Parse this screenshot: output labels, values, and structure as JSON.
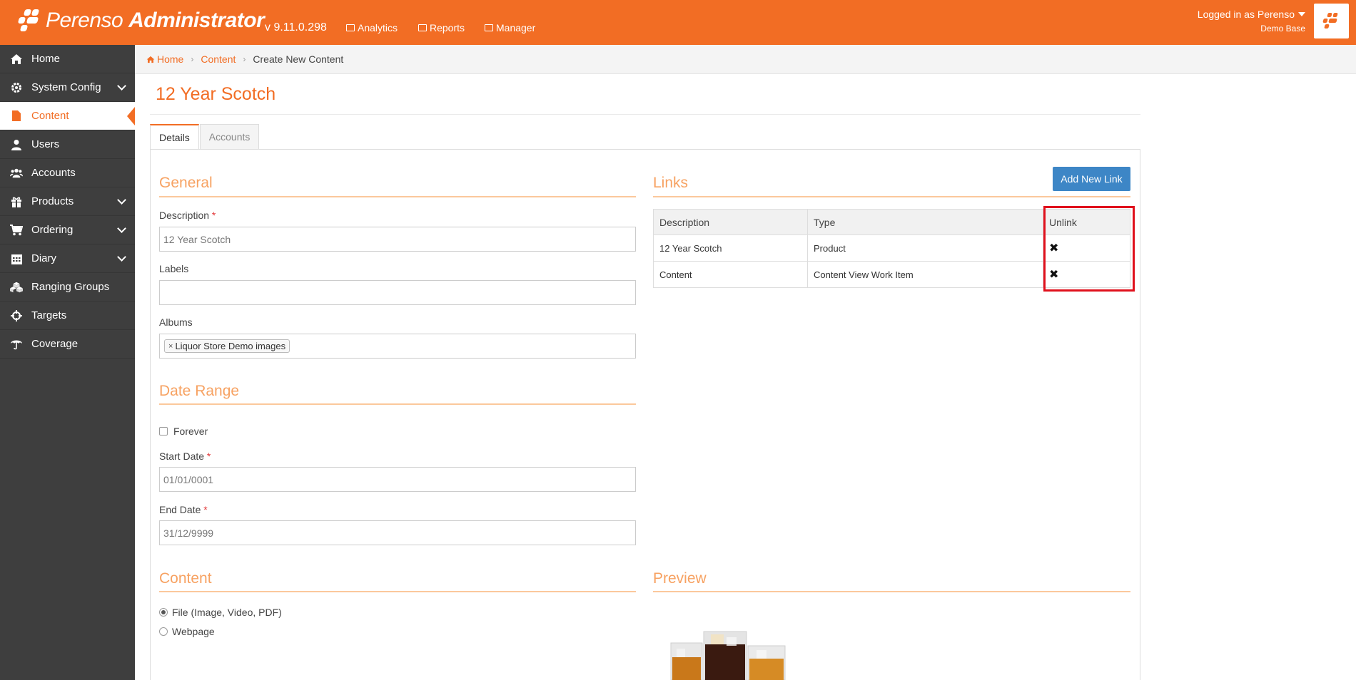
{
  "app": {
    "logo_text_1": "Perenso",
    "logo_text_2": "Administrator",
    "version": "v 9.11.0.298",
    "nav": [
      {
        "label": "Analytics",
        "icon": "chart-icon"
      },
      {
        "label": "Reports",
        "icon": "table-icon"
      },
      {
        "label": "Manager",
        "icon": "briefcase-icon"
      }
    ],
    "user": {
      "logged_in": "Logged in as Perenso",
      "base": "Demo Base"
    }
  },
  "sidebar": {
    "items": [
      {
        "label": "Home",
        "icon": "home-icon",
        "expandable": false,
        "active": false
      },
      {
        "label": "System Config",
        "icon": "gear-icon",
        "expandable": true,
        "active": false
      },
      {
        "label": "Content",
        "icon": "file-icon",
        "expandable": false,
        "active": true
      },
      {
        "label": "Users",
        "icon": "user-icon",
        "expandable": false,
        "active": false
      },
      {
        "label": "Accounts",
        "icon": "users-icon",
        "expandable": false,
        "active": false
      },
      {
        "label": "Products",
        "icon": "gift-icon",
        "expandable": true,
        "active": false
      },
      {
        "label": "Ordering",
        "icon": "cart-icon",
        "expandable": true,
        "active": false
      },
      {
        "label": "Diary",
        "icon": "calendar-icon",
        "expandable": true,
        "active": false
      },
      {
        "label": "Ranging Groups",
        "icon": "cubes-icon",
        "expandable": false,
        "active": false
      },
      {
        "label": "Targets",
        "icon": "crosshair-icon",
        "expandable": false,
        "active": false
      },
      {
        "label": "Coverage",
        "icon": "umbrella-icon",
        "expandable": false,
        "active": false
      }
    ]
  },
  "breadcrumb": {
    "home": "Home",
    "content": "Content",
    "current": "Create New Content"
  },
  "page": {
    "title": "12 Year Scotch"
  },
  "tabs": {
    "details": "Details",
    "accounts": "Accounts"
  },
  "general": {
    "heading": "General",
    "description_label": "Description",
    "description_value": "12 Year Scotch",
    "labels_label": "Labels",
    "labels_value": "",
    "albums_label": "Albums",
    "album_chip": "Liquor Store Demo images",
    "required_mark": "*"
  },
  "date_range": {
    "heading": "Date Range",
    "forever": "Forever",
    "start_label": "Start Date",
    "start_value": "01/01/0001",
    "end_label": "End Date",
    "end_value": "31/12/9999"
  },
  "content": {
    "heading": "Content",
    "options": [
      "File (Image, Video, PDF)",
      "Webpage"
    ],
    "selected": "File (Image, Video, PDF)"
  },
  "links": {
    "heading": "Links",
    "add_button": "Add New Link",
    "columns": [
      "Description",
      "Type",
      "Unlink"
    ],
    "rows": [
      {
        "description": "12 Year Scotch",
        "type": "Product",
        "unlink": "✖"
      },
      {
        "description": "Content",
        "type": "Content View Work Item",
        "unlink": "✖"
      }
    ]
  },
  "preview": {
    "heading": "Preview"
  },
  "colors": {
    "brand": "#f26d24",
    "sidebar": "#3e3e3e",
    "button": "#3d86c6",
    "highlight": "#e0101c"
  }
}
